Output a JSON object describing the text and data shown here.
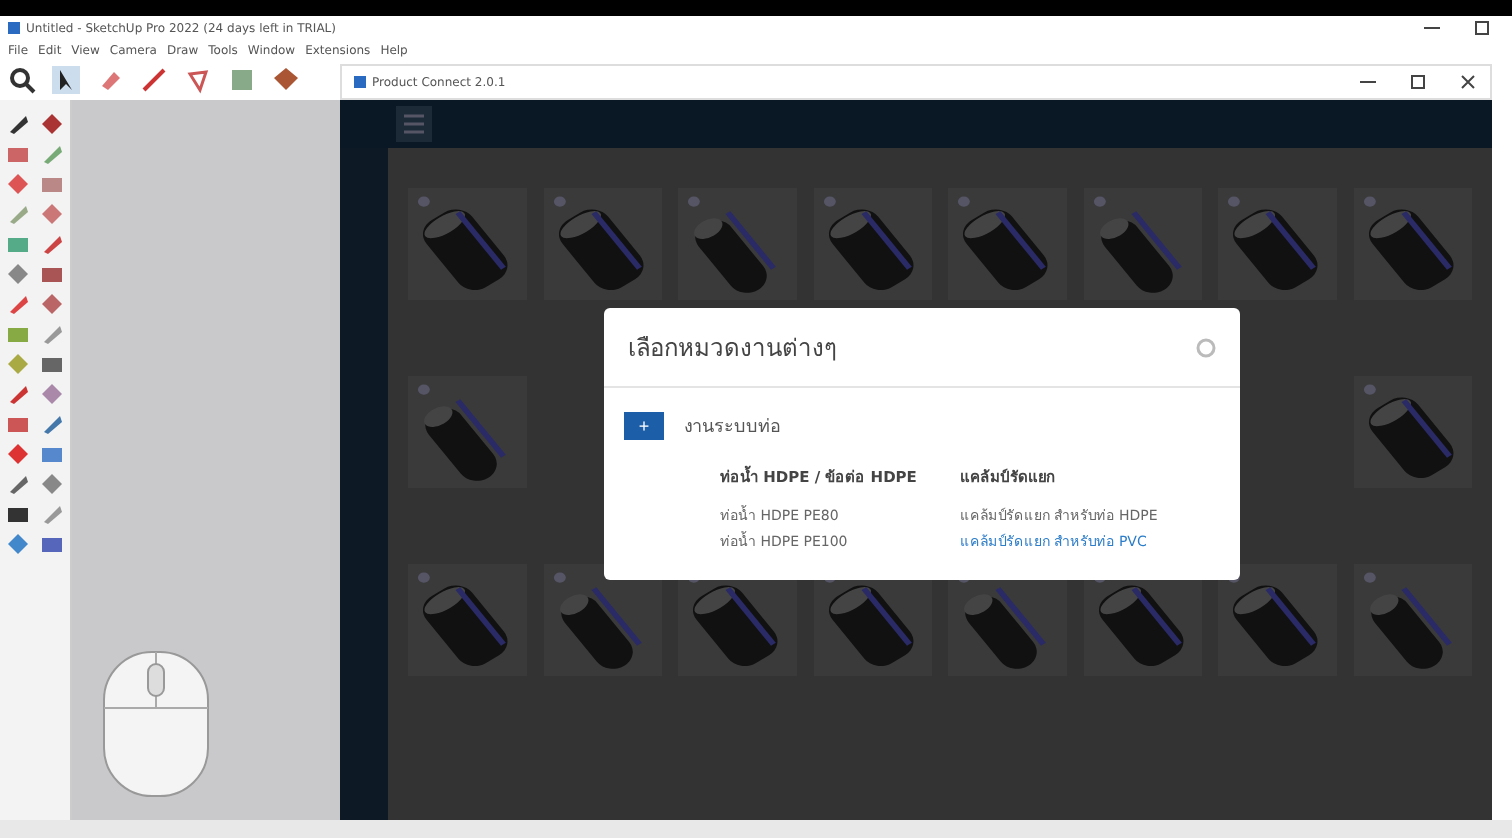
{
  "window": {
    "title": "Untitled - SketchUp Pro 2022 (24 days left in TRIAL)"
  },
  "menu": [
    "File",
    "Edit",
    "View",
    "Camera",
    "Draw",
    "Tools",
    "Window",
    "Extensions",
    "Help"
  ],
  "plugin_window": {
    "title": "Product Connect 2.0.1"
  },
  "dialog": {
    "title": "เลือกหมวดงานต่างๆ",
    "category": {
      "button": "+",
      "label": "งานระบบท่อ"
    },
    "columns": [
      {
        "heading": "ท่อน้ำ HDPE / ข้อต่อ HDPE",
        "items": [
          {
            "label": "ท่อน้ำ HDPE PE80",
            "kind": "text"
          },
          {
            "label": "ท่อน้ำ HDPE PE100",
            "kind": "text"
          }
        ]
      },
      {
        "heading": "แคล้มป์รัดแยก",
        "items": [
          {
            "label": "แคล้มป์รัดแยก สำหรับท่อ HDPE",
            "kind": "text"
          },
          {
            "label": "แคล้มป์รัดแยก สำหรับท่อ PVC",
            "kind": "link"
          }
        ]
      }
    ]
  }
}
